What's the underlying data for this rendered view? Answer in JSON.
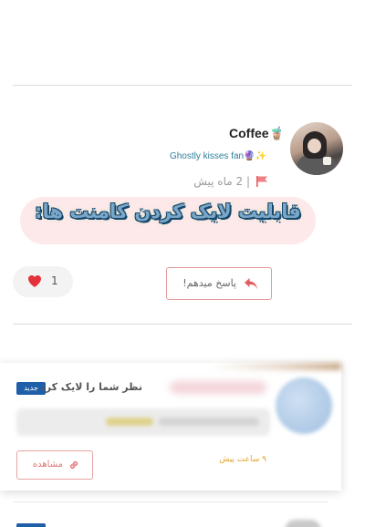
{
  "comment": {
    "username": "Coffee🧋",
    "badge_text": "Ghostly kisses fan🔮✨",
    "time_ago": "| 2 ماه پیش",
    "highlight_text": "قابلیت لایک کردن کامنت ها:",
    "like_count": "1",
    "reply_label": "پاسخ میدهم!"
  },
  "notification": {
    "new_badge": "جدید",
    "title": "نظر شما را لایک کرد",
    "view_label": "مشاهده",
    "time_ago": "۹ ساعت پیش"
  },
  "colors": {
    "accent_red": "#e35d5d",
    "badge_blue": "#1f5ea8",
    "highlight_pink": "#fde8ea",
    "time_orange": "#e0a42a"
  },
  "icons": [
    "flag-icon",
    "heart-icon",
    "reply-icon",
    "link-icon"
  ]
}
